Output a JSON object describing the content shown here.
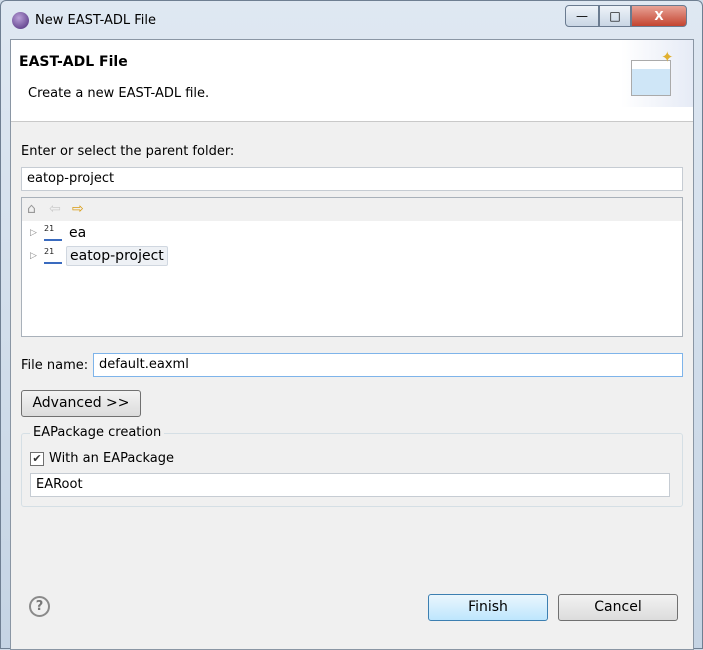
{
  "window": {
    "title": "New EAST-ADL File",
    "minimize": "—",
    "maximize": "□",
    "close": "X"
  },
  "header": {
    "title": "EAST-ADL File",
    "description": "Create a new EAST-ADL file."
  },
  "folder": {
    "label": "Enter or select the parent folder:",
    "value": "eatop-project"
  },
  "tree": {
    "toolbar": [
      "home-icon",
      "back-icon",
      "forward-icon"
    ],
    "items": [
      {
        "label": "ea",
        "selected": false
      },
      {
        "label": "eatop-project",
        "selected": true
      }
    ],
    "project_badge": "21"
  },
  "file": {
    "label": "File name:",
    "value": "default.eaxml"
  },
  "advanced_label": "Advanced >>",
  "package": {
    "group_label": "EAPackage creation",
    "checkbox_label": "With an EAPackage",
    "checked": true,
    "name": "EARoot"
  },
  "buttons": {
    "help": "?",
    "finish": "Finish",
    "cancel": "Cancel"
  }
}
